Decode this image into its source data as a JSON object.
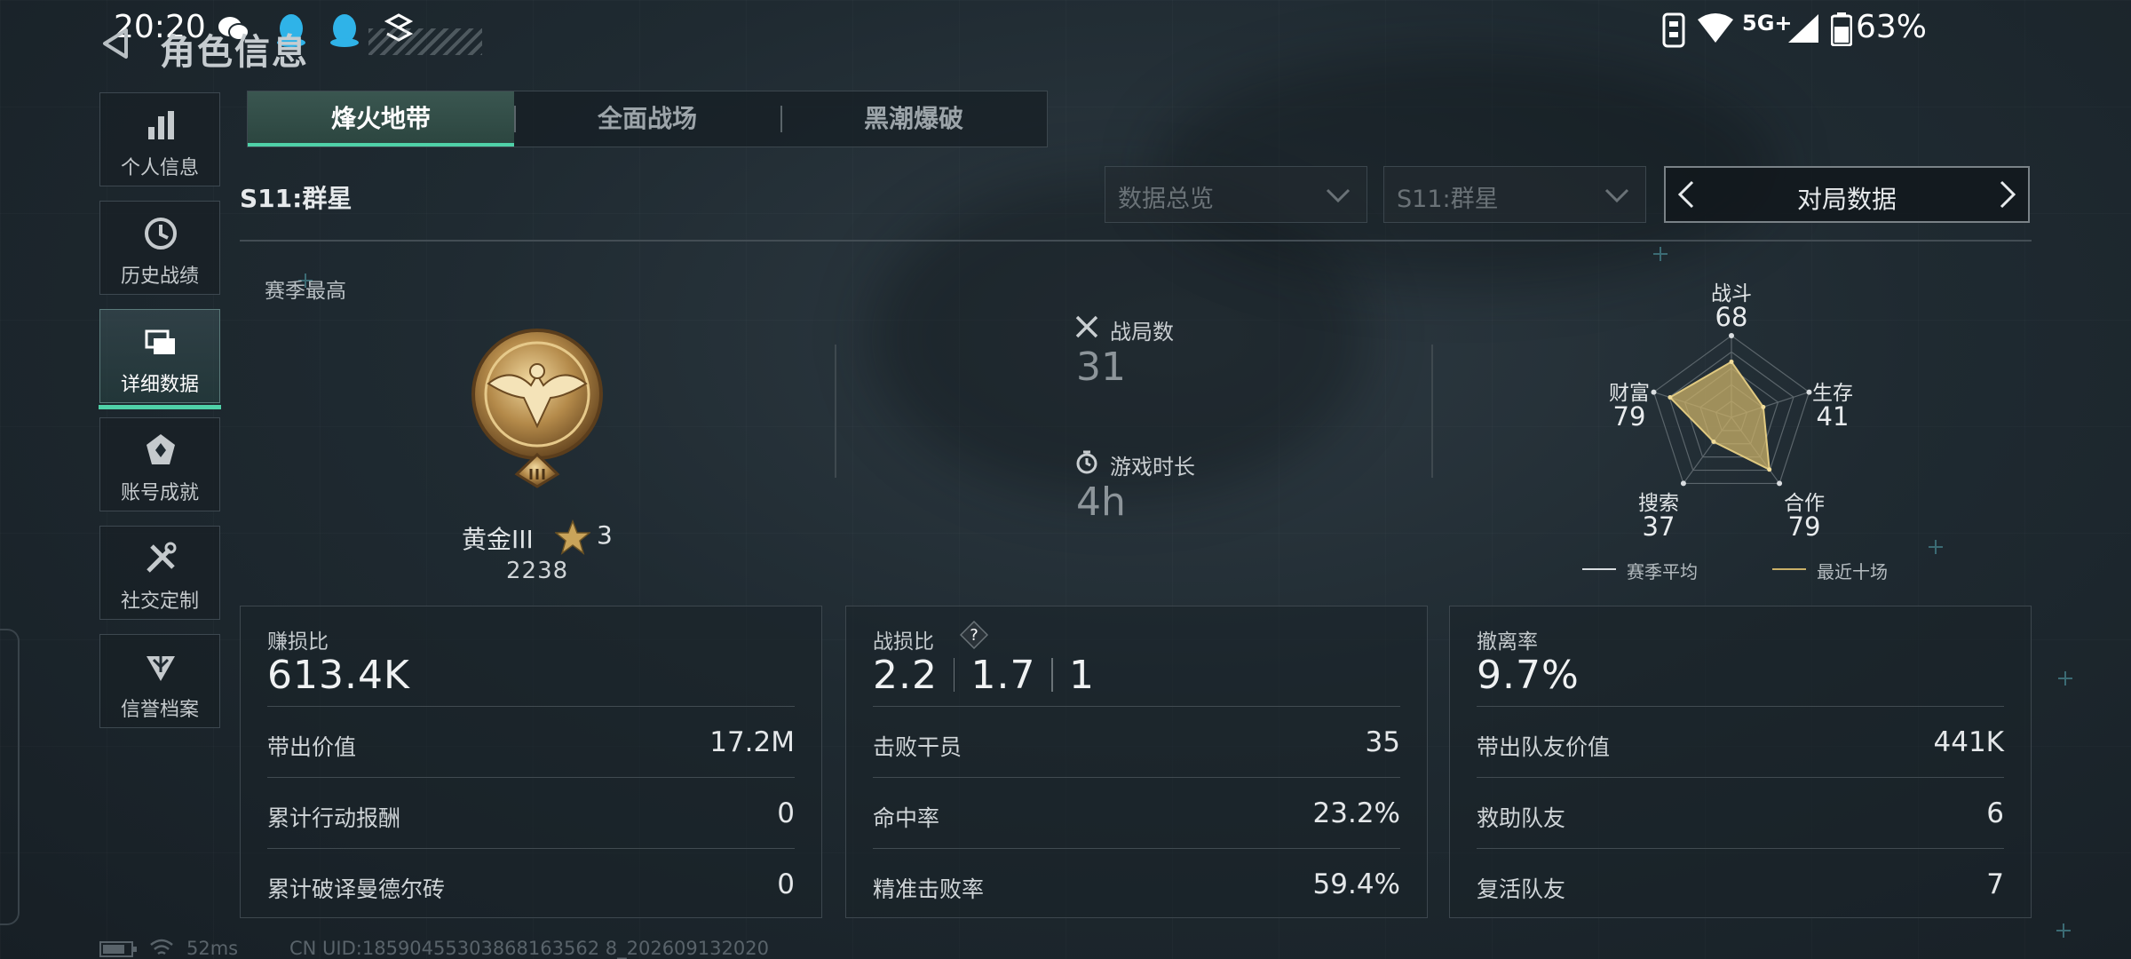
{
  "status_bar": {
    "time": "20:20",
    "network": "5G+",
    "battery": "63%"
  },
  "header": {
    "title": "角色信息"
  },
  "sidebar": {
    "items": [
      {
        "label": "个人信息",
        "icon": "bar-chart-icon"
      },
      {
        "label": "历史战绩",
        "icon": "history-clock-icon"
      },
      {
        "label": "详细数据",
        "icon": "cards-icon",
        "active": true
      },
      {
        "label": "账号成就",
        "icon": "achievement-icon"
      },
      {
        "label": "社交定制",
        "icon": "tools-icon"
      },
      {
        "label": "信誉档案",
        "icon": "credit-shield-icon"
      }
    ]
  },
  "tabs": [
    {
      "label": "烽火地带",
      "active": true
    },
    {
      "label": "全面战场"
    },
    {
      "label": "黑潮爆破"
    }
  ],
  "season_label": "S11:群星",
  "filters": {
    "overview_dropdown": "数据总览",
    "season_dropdown": "S11:群星",
    "data_switch": "对局数据"
  },
  "rank": {
    "section_label": "赛季最高",
    "name": "黄金III",
    "stars": "3",
    "score": "2238"
  },
  "matches": {
    "count_label": "战局数",
    "count_value": "31",
    "duration_label": "游戏时长",
    "duration_value": "4h"
  },
  "radar": {
    "axes": [
      {
        "label": "战斗",
        "value": 68
      },
      {
        "label": "生存",
        "value": 41
      },
      {
        "label": "合作",
        "value": 79
      },
      {
        "label": "搜索",
        "value": 37
      },
      {
        "label": "财富",
        "value": 79
      }
    ],
    "legend": [
      {
        "label": "赛季平均",
        "color": "#d9dde0"
      },
      {
        "label": "最近十场",
        "color": "#c9b068"
      }
    ],
    "series": [
      {
        "name": "最近十场",
        "values": [
          68,
          41,
          79,
          37,
          79
        ]
      }
    ]
  },
  "cards": {
    "profit": {
      "title": "赚损比",
      "value": "613.4K",
      "rows": [
        {
          "label": "带出价值",
          "value": "17.2M"
        },
        {
          "label": "累计行动报酬",
          "value": "0"
        },
        {
          "label": "累计破译曼德尔砖",
          "value": "0"
        }
      ]
    },
    "kd": {
      "title": "战损比",
      "help": "?",
      "values": [
        "2.2",
        "1.7",
        "1"
      ],
      "rows": [
        {
          "label": "击败干员",
          "value": "35"
        },
        {
          "label": "命中率",
          "value": "23.2%"
        },
        {
          "label": "精准击败率",
          "value": "59.4%"
        }
      ]
    },
    "extract": {
      "title": "撤离率",
      "value": "9.7%",
      "rows": [
        {
          "label": "带出队友价值",
          "value": "441K"
        },
        {
          "label": "救助队友",
          "value": "6"
        },
        {
          "label": "复活队友",
          "value": "7"
        }
      ]
    }
  },
  "footer": {
    "ping": "52ms",
    "uid": "CN UID:18590455303868163562 8_202609132020"
  },
  "colors": {
    "accent": "#4fd1a8",
    "radar_fill": "#c9b068"
  }
}
